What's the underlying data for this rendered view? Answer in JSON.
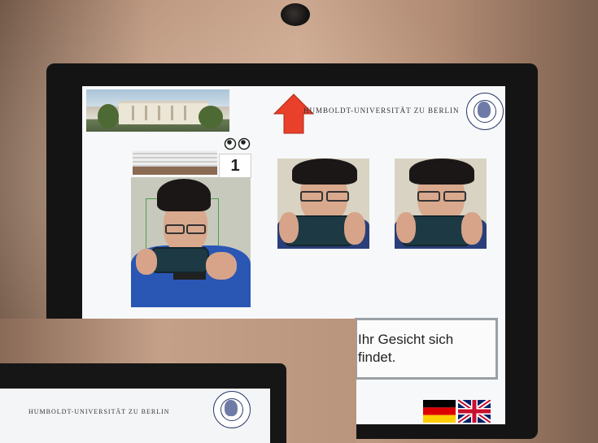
{
  "screen": {
    "university_name": "HUMBOLDT-UNIVERSITÄT ZU BERLIN",
    "seal_text": "HUMBOLDT-UNIVERSITÄT ZU BERLIN",
    "countdown": "1",
    "instruction_line1": "Ihr Gesicht sich",
    "instruction_line2": "findet."
  },
  "inset": {
    "university_name": "HUMBOLDT-UNIVERSITÄT ZU BERLIN"
  },
  "languages": [
    {
      "name": "Deutsch",
      "icon": "german-flag-icon"
    },
    {
      "name": "English",
      "icon": "uk-flag-icon"
    }
  ],
  "icons": {
    "arrow": "up-arrow-icon",
    "eyes": "eyes-icon",
    "seal": "university-seal-icon"
  },
  "colors": {
    "arrow_red": "#e8402a",
    "screen_bg": "#f7f8f9",
    "bezel": "#141414",
    "face_box_green": "#4aa04a"
  }
}
